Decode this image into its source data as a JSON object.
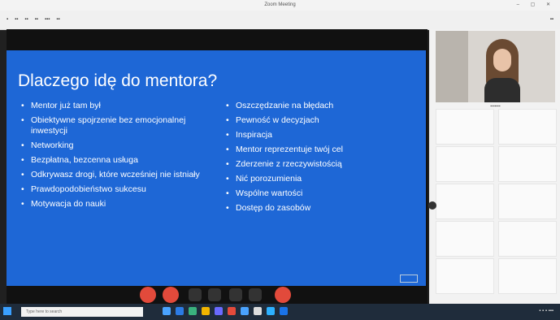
{
  "window": {
    "title": "Zoom Meeting"
  },
  "slide": {
    "title": "Dlaczego idę do mentora?",
    "left_items": [
      "Mentor już tam był",
      "Obiektywne spojrzenie bez emocjonalnej inwestycji",
      "Networking",
      "Bezpłatna, bezcenna usługa",
      "Odkrywasz drogi, które wcześniej nie istniały",
      "Prawdopodobieństwo sukcesu",
      "Motywacja do nauki"
    ],
    "right_items": [
      "Oszczędzanie na błędach",
      "Pewność w decyzjach",
      "Inspiracja",
      "Mentor reprezentuje twój cel",
      "Zderzenie z rzeczywistością",
      "Nić porozumienia",
      "Wspólne wartości",
      "Dostęp do zasobów"
    ]
  },
  "taskbar": {
    "search_placeholder": "Type here to search"
  },
  "colors": {
    "slide_bg": "#1e67d6",
    "control_red": "#e24a3b",
    "taskbar_bg": "#1f2c3b"
  },
  "icons": [
    "windows-start-icon",
    "mic-icon",
    "video-icon",
    "share-icon",
    "end-call-icon"
  ]
}
